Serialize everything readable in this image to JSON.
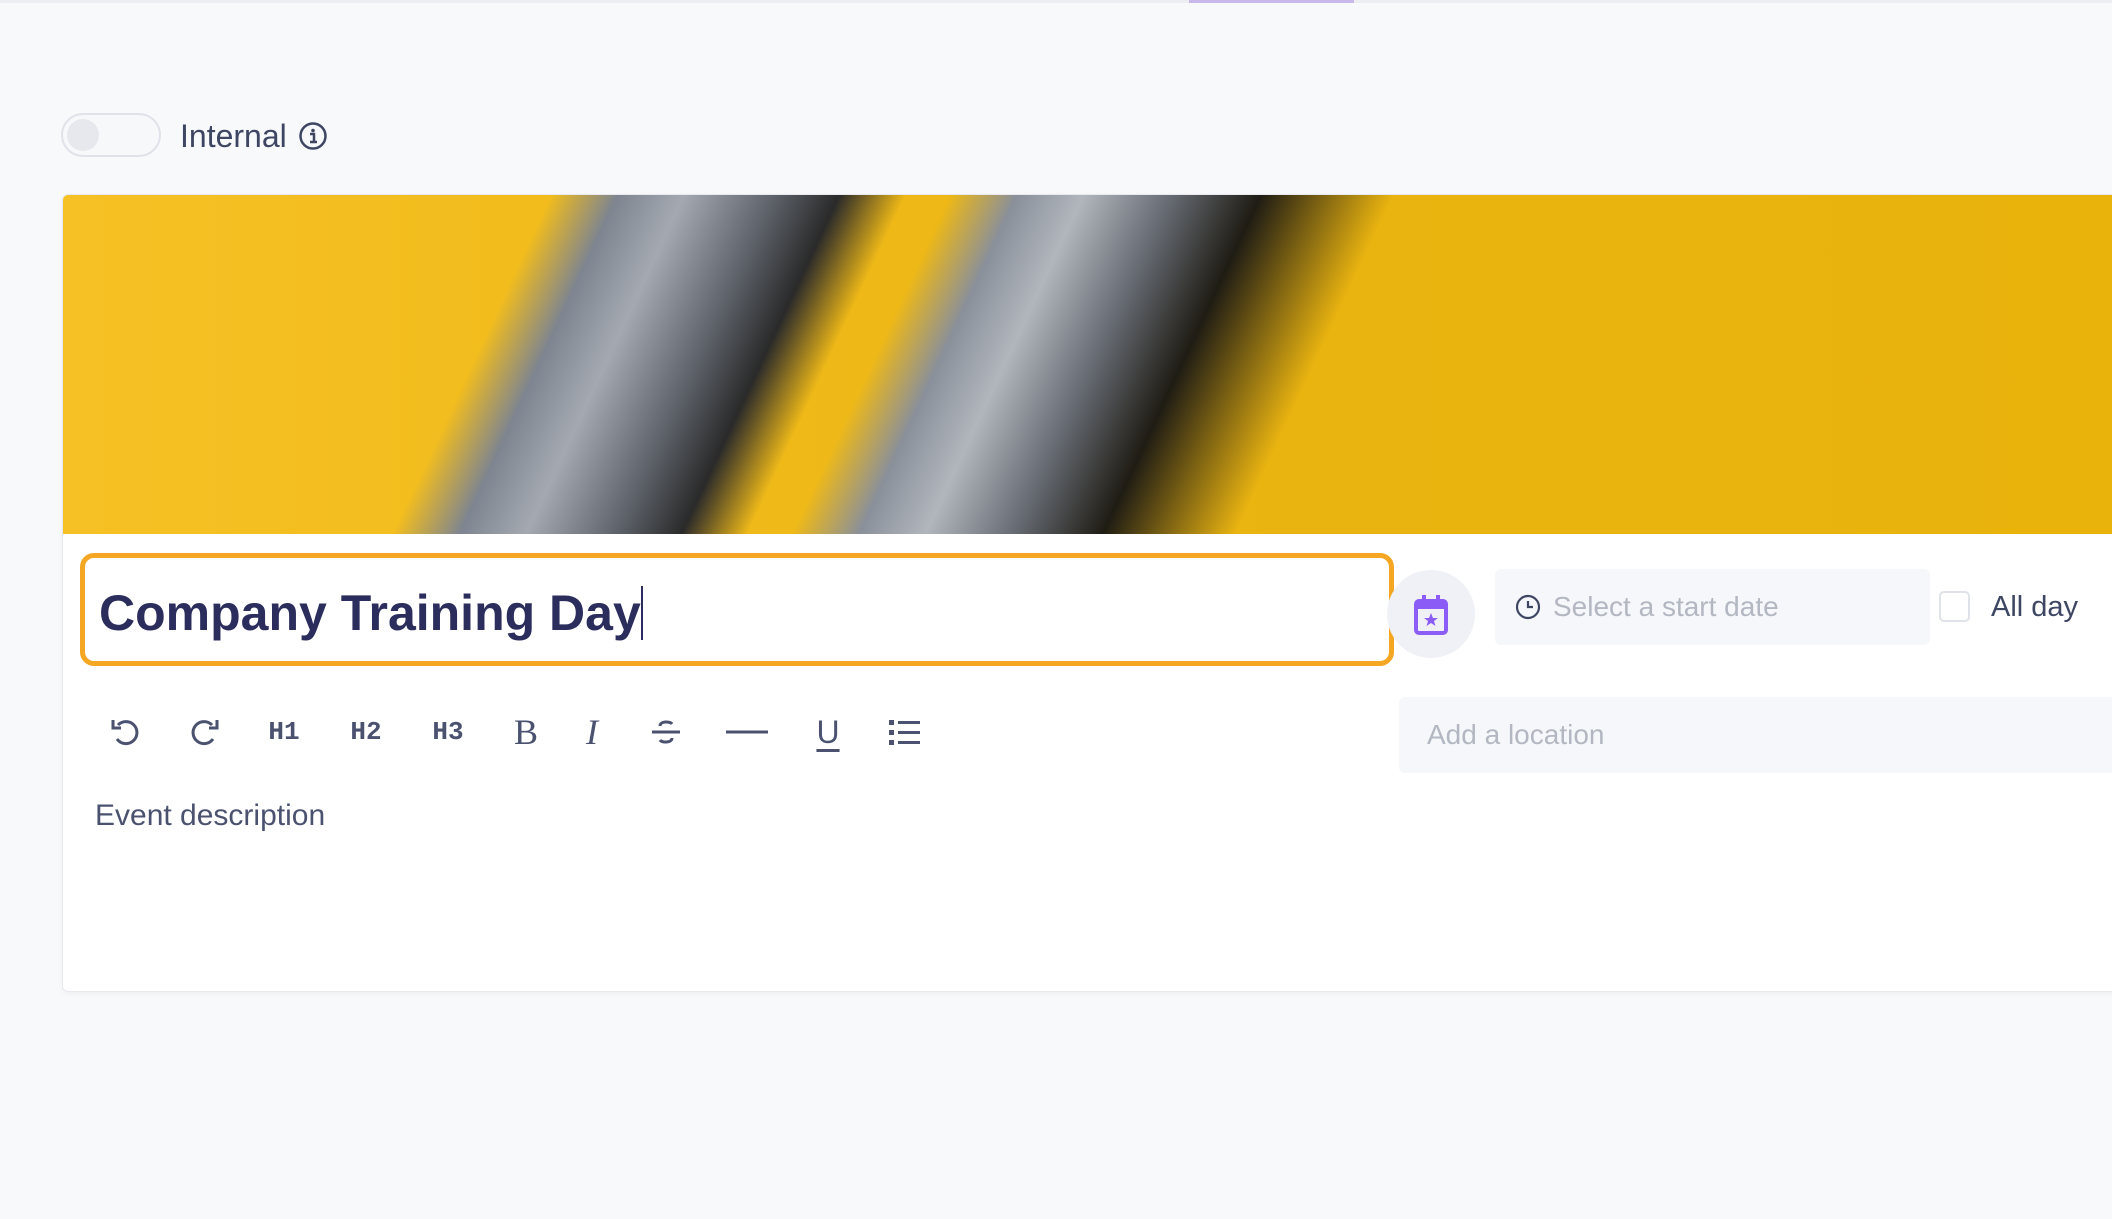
{
  "header": {
    "internal_label": "Internal",
    "internal_enabled": false
  },
  "event": {
    "title": "Company Training Day",
    "start_date_placeholder": "Select a start date",
    "all_day_label": "All day",
    "all_day_checked": false,
    "location_placeholder": "Add a location",
    "description_placeholder": "Event description"
  },
  "toolbar": {
    "h1": "H1",
    "h2": "H2",
    "h3": "H3",
    "bold": "B",
    "italic": "I",
    "underline": "U"
  },
  "colors": {
    "accent": "#8b5cf6",
    "title_border": "#f5a623",
    "title_text": "#2b2d5c"
  }
}
